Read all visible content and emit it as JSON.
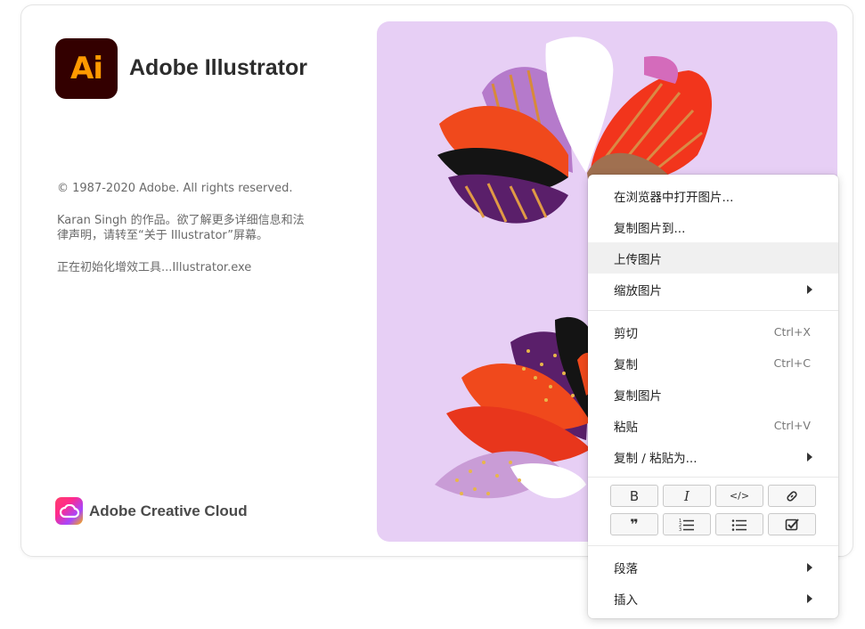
{
  "splash": {
    "logo_text": "Ai",
    "app_name": "Adobe Illustrator",
    "copyright": "© 1987-2020 Adobe. All rights reserved.",
    "credit_line1": "Karan  Singh 的作品。欲了解更多详细信息和法",
    "credit_line2": "律声明，请转至“关于 Illustrator”屏幕。",
    "status": "正在初始化增效工具...Illustrator.exe",
    "footer_brand": "Adobe Creative Cloud"
  },
  "context_menu": {
    "items": [
      {
        "label": "在浏览器中打开图片..."
      },
      {
        "label": "复制图片到..."
      },
      {
        "label": "上传图片",
        "highlighted": true
      },
      {
        "label": "缩放图片",
        "submenu": true
      },
      {
        "label": "剪切",
        "shortcut": "Ctrl+X"
      },
      {
        "label": "复制",
        "shortcut": "Ctrl+C"
      },
      {
        "label": "复制图片"
      },
      {
        "label": "粘贴",
        "shortcut": "Ctrl+V"
      },
      {
        "label": "复制 / 粘贴为...",
        "submenu": true
      },
      {
        "label": "段落",
        "submenu": true
      },
      {
        "label": "插入",
        "submenu": true
      }
    ],
    "format_buttons": {
      "bold": "B",
      "italic": "I",
      "code": "</>",
      "quote": "❞"
    }
  },
  "colors": {
    "ai_logo_bg": "#330000",
    "ai_logo_text": "#ff9a00",
    "art_bg": "#e7cff5",
    "menu_highlight": "#f0f0f0"
  },
  "icons": [
    "link-icon",
    "ordered-list-icon",
    "bullet-list-icon",
    "checkbox-icon",
    "submenu-arrow-icon",
    "creative-cloud-icon"
  ]
}
